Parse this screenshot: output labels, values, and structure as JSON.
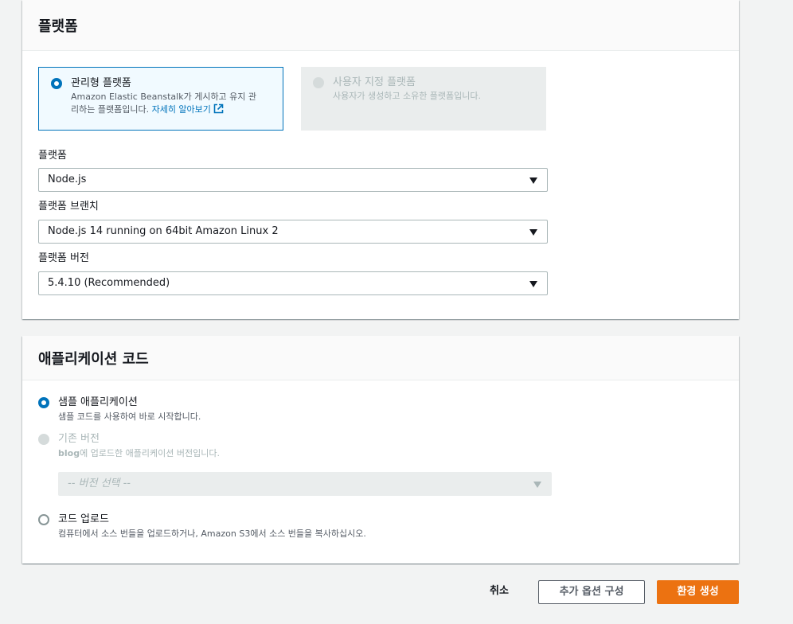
{
  "platform_panel": {
    "title": "플랫폼",
    "managed_tile": {
      "title": "관리형 플랫폼",
      "desc_line1": "Amazon Elastic Beanstalk가 게시하고 유지 관",
      "desc_line2": "리하는 플랫폼입니다.",
      "learn_more": "자세히 알아보기",
      "selected": true
    },
    "custom_tile": {
      "title": "사용자 지정 플랫폼",
      "desc": "사용자가 생성하고 소유한 플랫폼입니다.",
      "disabled": true
    },
    "platform_label": "플랫폼",
    "platform_value": "Node.js",
    "branch_label": "플랫폼 브랜치",
    "branch_value": "Node.js 14 running on 64bit Amazon Linux 2",
    "version_label": "플랫폼 버전",
    "version_value": "5.4.10 (Recommended)"
  },
  "app_panel": {
    "title": "애플리케이션 코드",
    "sample": {
      "title": "샘플 애플리케이션",
      "desc": "샘플 코드를 사용하여 바로 시작합니다.",
      "selected": true
    },
    "existing": {
      "title": "기존 버전",
      "desc_bold": "blog",
      "desc_rest": "에 업로드한 애플리케이션 버전입니다.",
      "select_placeholder": "-- 버전 선택 --",
      "disabled": true
    },
    "upload": {
      "title": "코드 업로드",
      "desc": "컴퓨터에서 소스 번들을 업로드하거나, Amazon S3에서 소스 번들을 복사하십시오."
    }
  },
  "actions": {
    "cancel": "취소",
    "more_options": "추가 옵션 구성",
    "create": "환경 생성"
  },
  "colors": {
    "accent": "#0073bb",
    "primary_button": "#ec7211",
    "background": "#f2f3f3"
  },
  "icons": [
    "external-link-icon",
    "chevron-down-icon"
  ]
}
